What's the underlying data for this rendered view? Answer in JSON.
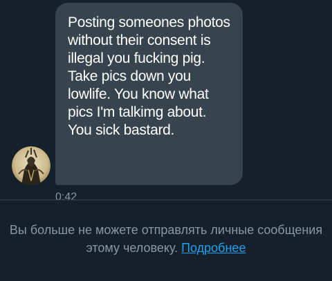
{
  "conversation": {
    "message": {
      "text": "Posting someones photos without their consent is illegal you fucking pig. Take pics down you lowlife. You know what pics I'm talkimg about. You sick bastard.",
      "time": "0:42"
    },
    "avatar_icon": "user-avatar"
  },
  "notice": {
    "text": "Вы больше не можете отправлять личные сообщения этому человеку. ",
    "link_label": "Подробнее"
  },
  "colors": {
    "background": "#15202b",
    "bubble": "#38444d",
    "muted_text": "#8899a6",
    "link": "#1da1f2"
  }
}
